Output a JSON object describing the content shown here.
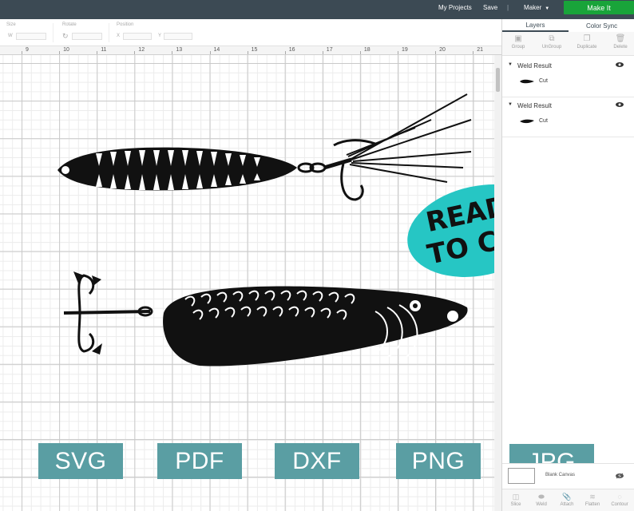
{
  "topbar": {
    "my_projects": "My Projects",
    "save": "Save",
    "divider": "|",
    "machine": "Maker",
    "make_it": "Make It",
    "accent_color": "#19a43a",
    "bar_color": "#3c4a54"
  },
  "editbar": {
    "size_label": "Size",
    "w_label": "W",
    "rotate_label": "Rotate",
    "position_label": "Position",
    "x_label": "X",
    "y_label": "Y"
  },
  "ruler": {
    "marks": [
      "9",
      "10",
      "11",
      "12",
      "13",
      "14",
      "15",
      "16",
      "17",
      "18",
      "19",
      "20",
      "21"
    ]
  },
  "panel": {
    "tabs": [
      "Layers",
      "Color Sync"
    ],
    "tools": [
      {
        "label": "Group",
        "icon": "group-icon"
      },
      {
        "label": "UnGroup",
        "icon": "ungroup-icon"
      },
      {
        "label": "Duplicate",
        "icon": "duplicate-icon"
      },
      {
        "label": "Delete",
        "icon": "trash-icon"
      }
    ],
    "layers": [
      {
        "title": "Weld Result",
        "item": "Cut"
      },
      {
        "title": "Weld Result",
        "item": "Cut"
      }
    ],
    "blank_canvas": "Blank Canvas",
    "bottom_tools": [
      {
        "label": "Slice",
        "icon": "slice-icon"
      },
      {
        "label": "Weld",
        "icon": "weld-icon"
      },
      {
        "label": "Attach",
        "icon": "attach-icon"
      },
      {
        "label": "Flatten",
        "icon": "flatten-icon"
      },
      {
        "label": "Contour",
        "icon": "contour-icon"
      }
    ]
  },
  "canvas": {
    "ready_line1": "READY",
    "ready_line2": "TO CUT",
    "formats": [
      "SVG",
      "PDF",
      "DXF",
      "PNG",
      "JPG"
    ],
    "badge_color": "#5a9ea3",
    "oval_color": "#26c6c4"
  }
}
